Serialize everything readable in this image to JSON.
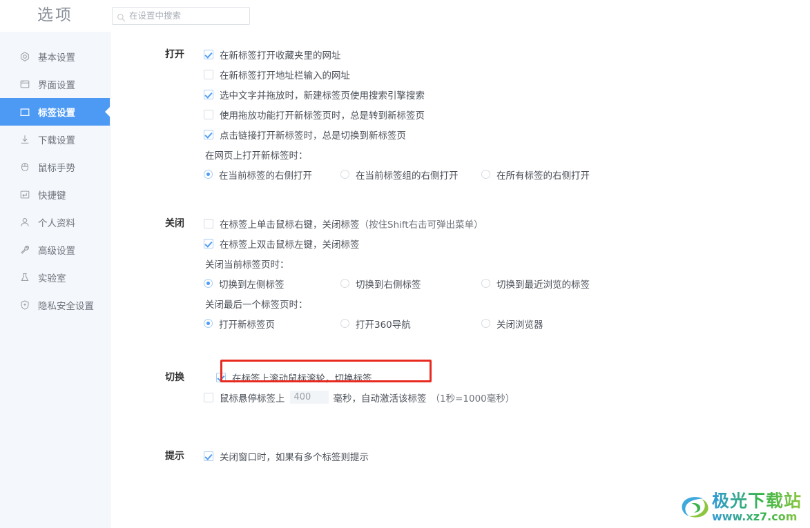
{
  "header": {
    "app_title": "选项",
    "search": {
      "placeholder": "在设置中搜索",
      "value": "",
      "icon": "search-icon"
    }
  },
  "sidebar": {
    "items": [
      {
        "label": "基本设置",
        "icon": "hexagon-target-icon",
        "active": false
      },
      {
        "label": "界面设置",
        "icon": "window-icon",
        "active": false
      },
      {
        "label": "标签设置",
        "icon": "tab-icon",
        "active": true
      },
      {
        "label": "下载设置",
        "icon": "download-arrow-icon",
        "active": false
      },
      {
        "label": "鼠标手势",
        "icon": "mouse-icon",
        "active": false
      },
      {
        "label": "快捷键",
        "icon": "keyboard-enter-icon",
        "active": false
      },
      {
        "label": "个人资料",
        "icon": "person-icon",
        "active": false
      },
      {
        "label": "高级设置",
        "icon": "wrench-icon",
        "active": false
      },
      {
        "label": "实验室",
        "icon": "flask-icon",
        "active": false
      },
      {
        "label": "隐私安全设置",
        "icon": "shield-plus-icon",
        "active": false
      }
    ],
    "active_accent": "#4d9af5"
  },
  "sections": {
    "open": {
      "label": "打开",
      "checkboxes": [
        {
          "label": "在新标签打开收藏夹里的网址",
          "checked": true
        },
        {
          "label": "在新标签打开地址栏输入的网址",
          "checked": false
        },
        {
          "label": "选中文字并拖放时，新建标签页使用搜索引擎搜索",
          "checked": true
        },
        {
          "label": "使用拖放功能打开新标签页时，总是转到新标签页",
          "checked": false
        },
        {
          "label": "点击链接打开新标签时，总是切换到新标签页",
          "checked": true
        }
      ],
      "radio_label": "在网页上打开新标签时：",
      "radios": [
        {
          "label": "在当前标签的右侧打开",
          "selected": true
        },
        {
          "label": "在当前标签组的右侧打开",
          "selected": false
        },
        {
          "label": "在所有标签的右侧打开",
          "selected": false
        }
      ]
    },
    "close": {
      "label": "关闭",
      "checkboxes": [
        {
          "label": "在标签上单击鼠标右键，关闭标签",
          "note": "（按住Shift右击可弹出菜单）",
          "checked": false
        },
        {
          "label": "在标签上双击鼠标左键，关闭标签",
          "note": "",
          "checked": true
        }
      ],
      "radio_label_1": "关闭当前标签页时：",
      "radios_1": [
        {
          "label": "切换到左侧标签",
          "selected": true
        },
        {
          "label": "切换到右侧标签",
          "selected": false
        },
        {
          "label": "切换到最近浏览的标签",
          "selected": false
        }
      ],
      "radio_label_2": "关闭最后一个标签页时：",
      "radios_2": [
        {
          "label": "打开新标签页",
          "selected": true
        },
        {
          "label": "打开360导航",
          "selected": false
        },
        {
          "label": "关闭浏览器",
          "selected": false
        }
      ]
    },
    "switch": {
      "label": "切换",
      "scroll_option": {
        "label": "在标签上滚动鼠标滚轮，切换标签",
        "checked": true
      },
      "hover_option": {
        "checked": false,
        "text_before": "鼠标悬停标签上",
        "value": "400",
        "text_after": "毫秒，自动激活该标签",
        "note": "（1秒=1000毫秒）"
      },
      "highlight_color": "#e8291f"
    },
    "tip": {
      "label": "提示",
      "checkboxes": [
        {
          "label": "关闭窗口时，如果有多个标签则提示",
          "checked": true
        }
      ]
    }
  },
  "watermark": {
    "name": "极光下载站",
    "url": "www.xz7.com"
  }
}
